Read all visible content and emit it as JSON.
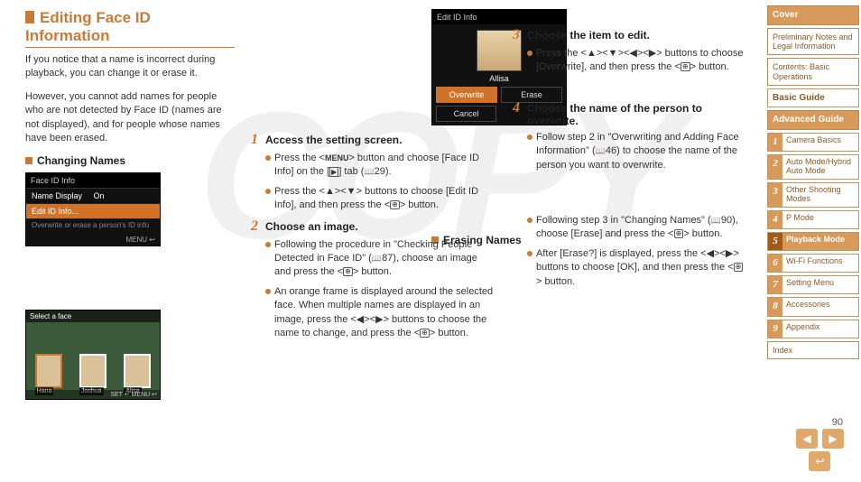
{
  "watermark": "COPY",
  "page_number": "90",
  "title": "Editing Face ID Information",
  "intro_p1": "If you notice that a name is incorrect during playback, you can change it or erase it.",
  "intro_p2": "However, you cannot add names for people who are not detected by Face ID (names are not displayed), and for people whose names have been erased.",
  "sections": {
    "changing": "Changing Names",
    "erasing": "Erasing Names"
  },
  "thumb1": {
    "header": "Face ID Info",
    "row1a": "Name Display",
    "row1b": "On",
    "row2": "Edit ID Info...",
    "desc": "Overwrite or erase a person's ID info",
    "foot": "MENU ↩"
  },
  "thumb2": {
    "header": "Select a face",
    "names": [
      "Hana",
      "Joshua",
      "Alisa"
    ],
    "foot": "SET ↵ MENU ↩"
  },
  "thumb3": {
    "header": "Edit ID Info",
    "name": "Allisa",
    "btn1": "Overwrite",
    "btn2": "Erase",
    "btn3": "Cancel"
  },
  "steps": {
    "s1": {
      "num": "1",
      "title": "Access the setting screen.",
      "b1a": "Press the <",
      "b1b": "> button and choose [Face ID Info] on the [",
      "b1c": "] tab (",
      "b1d": "29).",
      "menu_label": "MENU",
      "play_label": "▶",
      "b2a": "Press the <▲><▼> buttons to choose [Edit ID Info], and then press the <",
      "b2b": "> button.",
      "func": "FUNC SET"
    },
    "s2": {
      "num": "2",
      "title": "Choose an image.",
      "b1a": "Following the procedure in \"Checking People Detected in Face ID\" (",
      "b1b": "87), choose an image and press the <",
      "b1c": "> button.",
      "b2": "An orange frame is displayed around the selected face. When multiple names are displayed in an image, press the <◀><▶> buttons to choose the name to change, and press the <",
      "b2b": "> button."
    },
    "s3": {
      "num": "3",
      "title": "Choose the item to edit.",
      "b1": "Press the <▲><▼><◀><▶> buttons to choose [Overwrite], and then press the <",
      "b1b": "> button."
    },
    "s4": {
      "num": "4",
      "title": "Choose the name of the person to overwrite.",
      "b1a": "Follow step 2 in \"Overwriting and Adding Face Information\" (",
      "b1b": "46) to choose the name of the person you want to overwrite."
    },
    "erase": {
      "b1a": "Following step 3 in \"Changing Names\" (",
      "b1b": "90), choose [Erase] and press the <",
      "b1c": "> button.",
      "b2a": "After [Erase?] is displayed, press the <◀><▶> buttons to choose [OK], and then press the <",
      "b2b": "> button."
    }
  },
  "sidebar": {
    "cover": "Cover",
    "prelim": "Preliminary Notes and Legal Information",
    "contents": "Contents: Basic Operations",
    "basic": "Basic Guide",
    "advanced": "Advanced Guide",
    "chapters": [
      {
        "n": "1",
        "t": "Camera Basics"
      },
      {
        "n": "2",
        "t": "Auto Mode/Hybrid Auto Mode"
      },
      {
        "n": "3",
        "t": "Other Shooting Modes"
      },
      {
        "n": "4",
        "t": "P Mode"
      },
      {
        "n": "5",
        "t": "Playback Mode"
      },
      {
        "n": "6",
        "t": "Wi-Fi Functions"
      },
      {
        "n": "7",
        "t": "Setting Menu"
      },
      {
        "n": "8",
        "t": "Accessories"
      },
      {
        "n": "9",
        "t": "Appendix"
      }
    ],
    "index": "Index",
    "active_chapter": 4
  },
  "nav": {
    "prev": "◀",
    "next": "▶",
    "return": "↩"
  }
}
